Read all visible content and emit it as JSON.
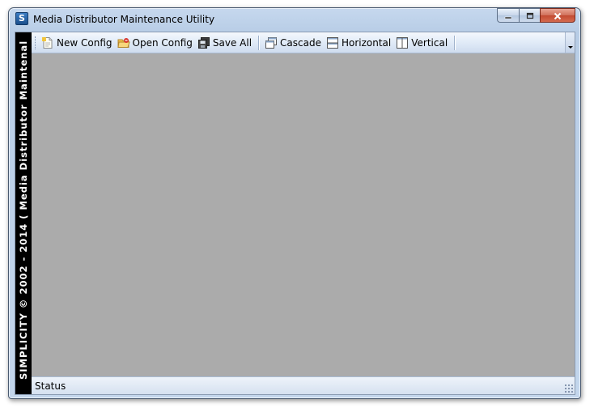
{
  "window": {
    "title": "Media Distributor Maintenance Utility",
    "app_icon_letter": "S",
    "buttons": {
      "minimize": "minimize-icon",
      "maximize": "maximize-icon",
      "close": "close-icon"
    }
  },
  "side_banner": {
    "text": "SIMPLICITY © 2002 - 2014 ( Media Distributor Maintenal"
  },
  "toolbar": {
    "items": [
      {
        "label": "New Config",
        "icon": "new-document-icon"
      },
      {
        "label": "Open Config",
        "icon": "open-folder-icon"
      },
      {
        "label": "Save All",
        "icon": "save-all-icon"
      },
      {
        "label": "Cascade",
        "icon": "cascade-windows-icon"
      },
      {
        "label": "Horizontal",
        "icon": "tile-horizontal-icon"
      },
      {
        "label": "Vertical",
        "icon": "tile-vertical-icon"
      }
    ]
  },
  "statusbar": {
    "label": "Status"
  },
  "colors": {
    "mdi_background": "#ababab",
    "banner_background": "#000000",
    "title_frame": "#c6d8ee"
  }
}
